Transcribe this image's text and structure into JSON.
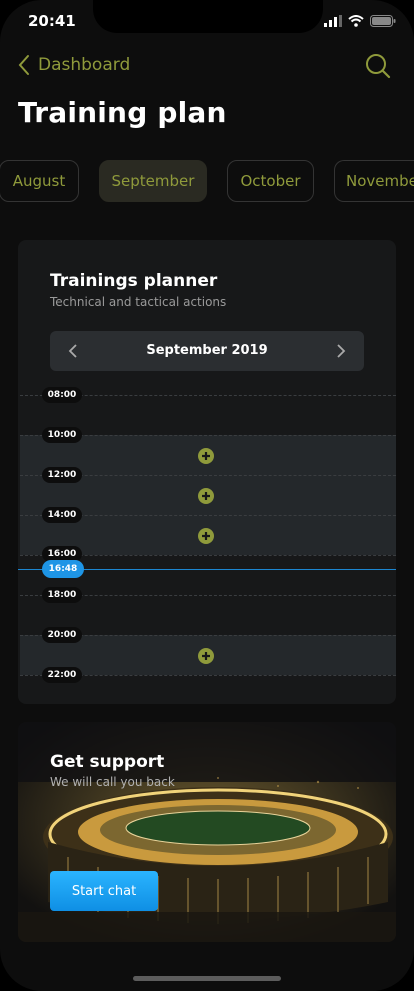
{
  "status": {
    "time": "20:41"
  },
  "nav": {
    "back_label": "Dashboard"
  },
  "page": {
    "title": "Training plan"
  },
  "months": [
    {
      "label": "August",
      "selected": false
    },
    {
      "label": "September",
      "selected": true
    },
    {
      "label": "October",
      "selected": false
    },
    {
      "label": "November",
      "selected": false
    }
  ],
  "planner": {
    "title": "Trainings planner",
    "subtitle": "Technical and tactical actions",
    "month_label": "September 2019",
    "times": [
      "08:00",
      "10:00",
      "12:00",
      "14:00",
      "16:00",
      "18:00",
      "20:00",
      "22:00"
    ],
    "current_time": "16:48"
  },
  "support": {
    "title": "Get support",
    "subtitle": "We will call you back",
    "button_label": "Start chat"
  },
  "colors": {
    "accent": "#8f9a3b",
    "blue": "#1e95e6",
    "background": "#0d0d0d"
  }
}
